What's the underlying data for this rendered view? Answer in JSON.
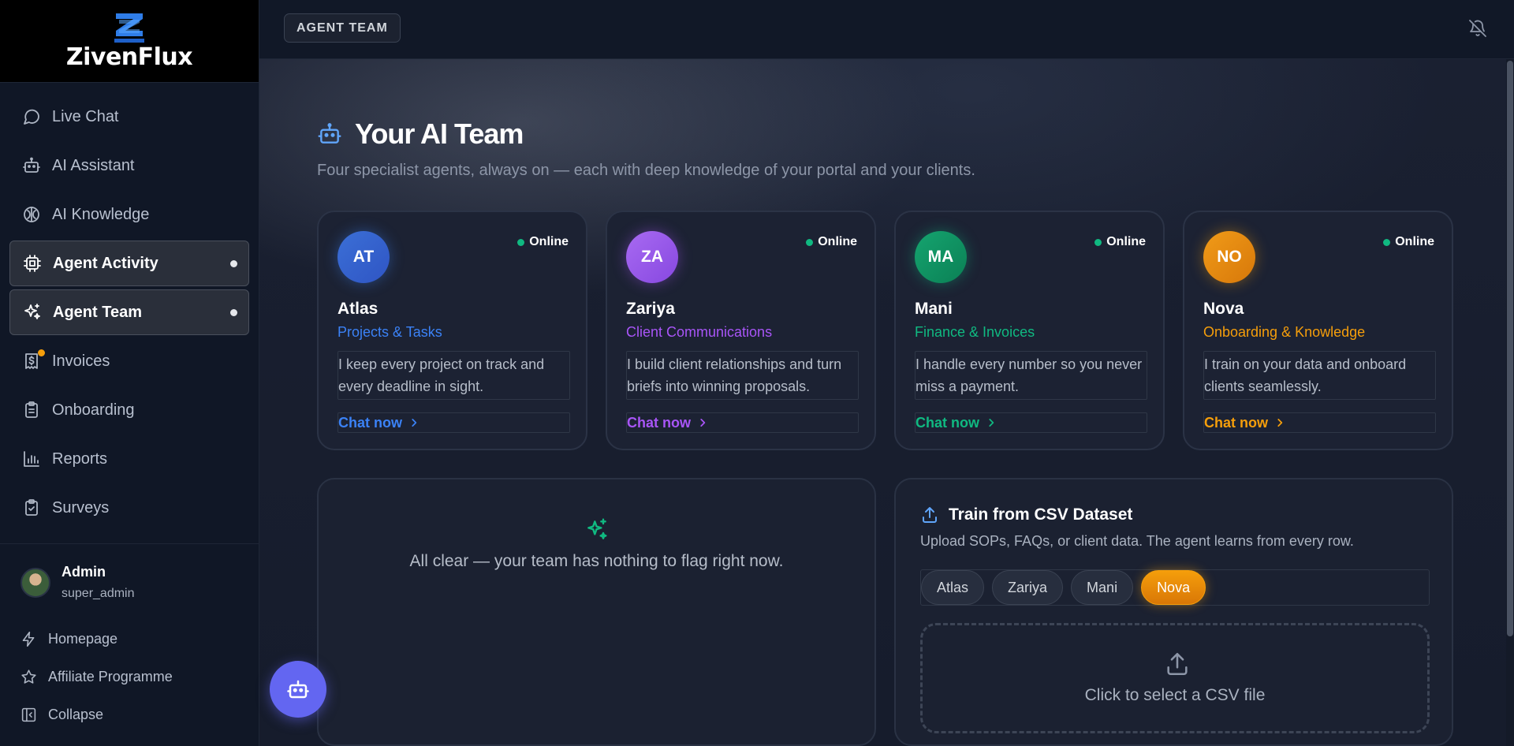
{
  "brand": {
    "name": "ZivenFlux"
  },
  "nav": {
    "items": [
      {
        "label": "Live Chat",
        "icon": "chat-bubble-icon"
      },
      {
        "label": "AI Assistant",
        "icon": "robot-icon"
      },
      {
        "label": "AI Knowledge",
        "icon": "brain-icon"
      },
      {
        "label": "Agent Activity",
        "icon": "cpu-icon",
        "active": true
      },
      {
        "label": "Agent Team",
        "icon": "sparkles-icon",
        "active": true
      },
      {
        "label": "Invoices",
        "icon": "invoice-dollar-icon",
        "notification": true
      },
      {
        "label": "Onboarding",
        "icon": "clipboard-list-icon"
      },
      {
        "label": "Reports",
        "icon": "bar-chart-icon"
      },
      {
        "label": "Surveys",
        "icon": "clipboard-check-icon"
      }
    ]
  },
  "user": {
    "name": "Admin",
    "role": "super_admin"
  },
  "footer": {
    "homepage": "Homepage",
    "affiliate": "Affiliate Programme",
    "collapse": "Collapse"
  },
  "topbar": {
    "breadcrumb": "AGENT TEAM"
  },
  "page": {
    "title": "Your AI Team",
    "subtitle": "Four specialist agents, always on — each with deep knowledge of your portal and your clients."
  },
  "agents": [
    {
      "initials": "AT",
      "name": "Atlas",
      "role": "Projects & Tasks",
      "status": "Online",
      "description": "I keep every project on track and every deadline in sight.",
      "cta": "Chat now",
      "color": "#3b82f6",
      "avatar_from": "#3b6fd6",
      "avatar_to": "#2f55c4"
    },
    {
      "initials": "ZA",
      "name": "Zariya",
      "role": "Client Communications",
      "status": "Online",
      "description": "I build client relationships and turn briefs into winning proposals.",
      "cta": "Chat now",
      "color": "#a855f7",
      "avatar_from": "#a86af2",
      "avatar_to": "#8748e0"
    },
    {
      "initials": "MA",
      "name": "Mani",
      "role": "Finance & Invoices",
      "status": "Online",
      "description": "I handle every number so you never miss a payment.",
      "cta": "Chat now",
      "color": "#10b981",
      "avatar_from": "#15a46f",
      "avatar_to": "#0b8055"
    },
    {
      "initials": "NO",
      "name": "Nova",
      "role": "Onboarding & Knowledge",
      "status": "Online",
      "description": "I train on your data and onboard clients seamlessly.",
      "cta": "Chat now",
      "color": "#f59e0b",
      "avatar_from": "#f19b18",
      "avatar_to": "#d7780a"
    }
  ],
  "alerts": {
    "text": "All clear — your team has nothing to flag right now."
  },
  "csv": {
    "title": "Train from CSV Dataset",
    "subtitle": "Upload SOPs, FAQs, or client data. The agent learns from every row.",
    "agents": [
      "Atlas",
      "Zariya",
      "Mani",
      "Nova"
    ],
    "selected": "Nova",
    "drop_text": "Click to select a CSV file"
  },
  "colors": {
    "accent_blue": "#3b82f6",
    "fab": "#6366f1",
    "online": "#10b981",
    "sidebar_bg": "#101726",
    "main_bg": "#161c2c"
  }
}
